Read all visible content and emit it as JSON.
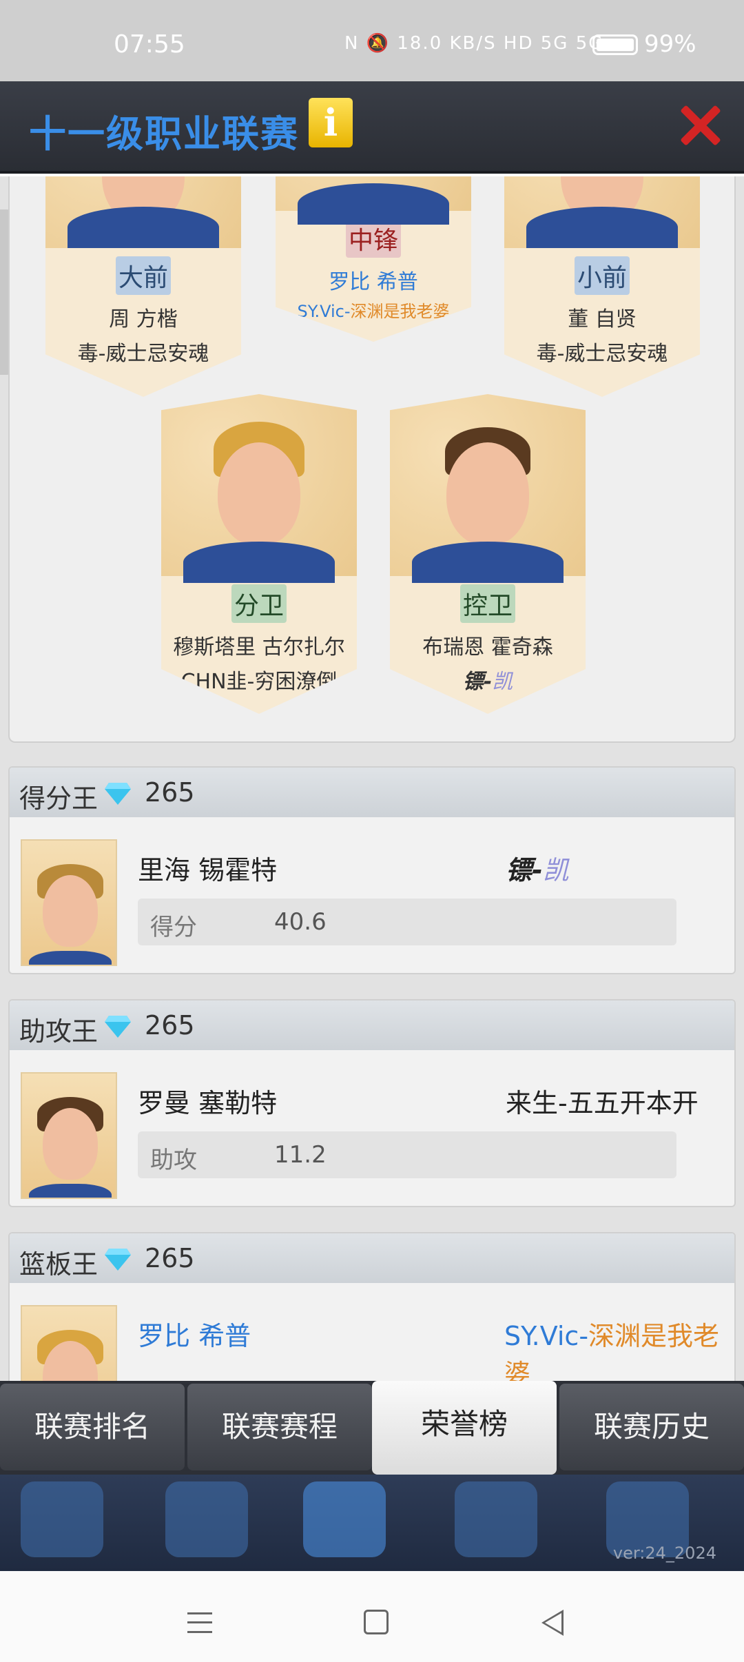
{
  "status_bar": {
    "time": "07:55",
    "icons_text": "N  🔕  18.0 KB/S  HD  5G  5G",
    "battery_pct": "99%"
  },
  "header": {
    "title": "十一级职业联赛",
    "info_label": "i"
  },
  "lineup": [
    {
      "position": "大前",
      "name": "周 方楷",
      "team": "毒-威士忌安魂"
    },
    {
      "position": "中锋",
      "name": "罗比 希普",
      "team_part1": "SY.Vic-",
      "team_part2": "深渊是我老婆"
    },
    {
      "position": "小前",
      "name": "董 自贤",
      "team": "毒-威士忌安魂"
    },
    {
      "position": "分卫",
      "name": "穆斯塔里 古尔扎尔",
      "team": "CHN韭-穷困潦倒"
    },
    {
      "position": "控卫",
      "name": "布瑞恩 霍奇森",
      "team_part1": "镖-",
      "team_part2": "凯"
    }
  ],
  "awards": [
    {
      "title": "得分王",
      "reward": "265",
      "player": "里海 锡霍特",
      "team_part1": "镖-",
      "team_part2": "凯",
      "stat_label": "得分",
      "stat_value": "40.6"
    },
    {
      "title": "助攻王",
      "reward": "265",
      "player": "罗曼 塞勒特",
      "team": "来生-五五开本开",
      "stat_label": "助攻",
      "stat_value": "11.2"
    },
    {
      "title": "篮板王",
      "reward": "265",
      "player": "罗比 希普",
      "team_part1": "SY.Vic-",
      "team_part2": "深渊是我老婆"
    }
  ],
  "tabs": [
    "联赛排名",
    "联赛赛程",
    "荣誉榜",
    "联赛历史"
  ],
  "active_tab": "荣誉榜",
  "version": "ver:24_2024",
  "colors": {
    "accent_blue": "#3a8ee8",
    "team_orange": "#e08a2a",
    "close_red": "#d42424"
  }
}
